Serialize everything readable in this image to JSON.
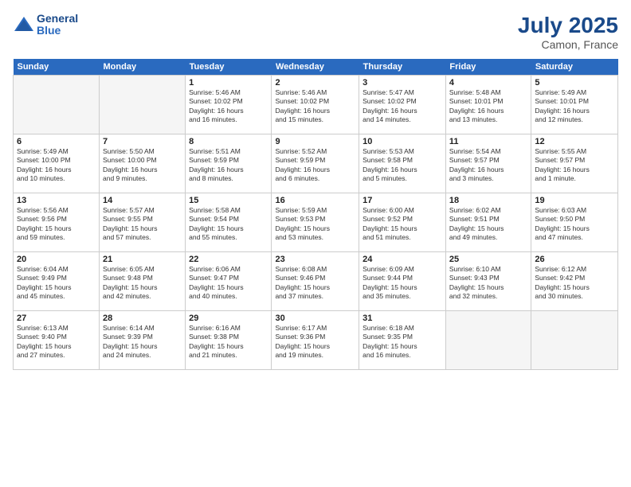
{
  "header": {
    "logo_line1": "General",
    "logo_line2": "Blue",
    "month": "July 2025",
    "location": "Camon, France"
  },
  "weekdays": [
    "Sunday",
    "Monday",
    "Tuesday",
    "Wednesday",
    "Thursday",
    "Friday",
    "Saturday"
  ],
  "weeks": [
    [
      {
        "day": "",
        "info": ""
      },
      {
        "day": "",
        "info": ""
      },
      {
        "day": "1",
        "info": "Sunrise: 5:46 AM\nSunset: 10:02 PM\nDaylight: 16 hours\nand 16 minutes."
      },
      {
        "day": "2",
        "info": "Sunrise: 5:46 AM\nSunset: 10:02 PM\nDaylight: 16 hours\nand 15 minutes."
      },
      {
        "day": "3",
        "info": "Sunrise: 5:47 AM\nSunset: 10:02 PM\nDaylight: 16 hours\nand 14 minutes."
      },
      {
        "day": "4",
        "info": "Sunrise: 5:48 AM\nSunset: 10:01 PM\nDaylight: 16 hours\nand 13 minutes."
      },
      {
        "day": "5",
        "info": "Sunrise: 5:49 AM\nSunset: 10:01 PM\nDaylight: 16 hours\nand 12 minutes."
      }
    ],
    [
      {
        "day": "6",
        "info": "Sunrise: 5:49 AM\nSunset: 10:00 PM\nDaylight: 16 hours\nand 10 minutes."
      },
      {
        "day": "7",
        "info": "Sunrise: 5:50 AM\nSunset: 10:00 PM\nDaylight: 16 hours\nand 9 minutes."
      },
      {
        "day": "8",
        "info": "Sunrise: 5:51 AM\nSunset: 9:59 PM\nDaylight: 16 hours\nand 8 minutes."
      },
      {
        "day": "9",
        "info": "Sunrise: 5:52 AM\nSunset: 9:59 PM\nDaylight: 16 hours\nand 6 minutes."
      },
      {
        "day": "10",
        "info": "Sunrise: 5:53 AM\nSunset: 9:58 PM\nDaylight: 16 hours\nand 5 minutes."
      },
      {
        "day": "11",
        "info": "Sunrise: 5:54 AM\nSunset: 9:57 PM\nDaylight: 16 hours\nand 3 minutes."
      },
      {
        "day": "12",
        "info": "Sunrise: 5:55 AM\nSunset: 9:57 PM\nDaylight: 16 hours\nand 1 minute."
      }
    ],
    [
      {
        "day": "13",
        "info": "Sunrise: 5:56 AM\nSunset: 9:56 PM\nDaylight: 15 hours\nand 59 minutes."
      },
      {
        "day": "14",
        "info": "Sunrise: 5:57 AM\nSunset: 9:55 PM\nDaylight: 15 hours\nand 57 minutes."
      },
      {
        "day": "15",
        "info": "Sunrise: 5:58 AM\nSunset: 9:54 PM\nDaylight: 15 hours\nand 55 minutes."
      },
      {
        "day": "16",
        "info": "Sunrise: 5:59 AM\nSunset: 9:53 PM\nDaylight: 15 hours\nand 53 minutes."
      },
      {
        "day": "17",
        "info": "Sunrise: 6:00 AM\nSunset: 9:52 PM\nDaylight: 15 hours\nand 51 minutes."
      },
      {
        "day": "18",
        "info": "Sunrise: 6:02 AM\nSunset: 9:51 PM\nDaylight: 15 hours\nand 49 minutes."
      },
      {
        "day": "19",
        "info": "Sunrise: 6:03 AM\nSunset: 9:50 PM\nDaylight: 15 hours\nand 47 minutes."
      }
    ],
    [
      {
        "day": "20",
        "info": "Sunrise: 6:04 AM\nSunset: 9:49 PM\nDaylight: 15 hours\nand 45 minutes."
      },
      {
        "day": "21",
        "info": "Sunrise: 6:05 AM\nSunset: 9:48 PM\nDaylight: 15 hours\nand 42 minutes."
      },
      {
        "day": "22",
        "info": "Sunrise: 6:06 AM\nSunset: 9:47 PM\nDaylight: 15 hours\nand 40 minutes."
      },
      {
        "day": "23",
        "info": "Sunrise: 6:08 AM\nSunset: 9:46 PM\nDaylight: 15 hours\nand 37 minutes."
      },
      {
        "day": "24",
        "info": "Sunrise: 6:09 AM\nSunset: 9:44 PM\nDaylight: 15 hours\nand 35 minutes."
      },
      {
        "day": "25",
        "info": "Sunrise: 6:10 AM\nSunset: 9:43 PM\nDaylight: 15 hours\nand 32 minutes."
      },
      {
        "day": "26",
        "info": "Sunrise: 6:12 AM\nSunset: 9:42 PM\nDaylight: 15 hours\nand 30 minutes."
      }
    ],
    [
      {
        "day": "27",
        "info": "Sunrise: 6:13 AM\nSunset: 9:40 PM\nDaylight: 15 hours\nand 27 minutes."
      },
      {
        "day": "28",
        "info": "Sunrise: 6:14 AM\nSunset: 9:39 PM\nDaylight: 15 hours\nand 24 minutes."
      },
      {
        "day": "29",
        "info": "Sunrise: 6:16 AM\nSunset: 9:38 PM\nDaylight: 15 hours\nand 21 minutes."
      },
      {
        "day": "30",
        "info": "Sunrise: 6:17 AM\nSunset: 9:36 PM\nDaylight: 15 hours\nand 19 minutes."
      },
      {
        "day": "31",
        "info": "Sunrise: 6:18 AM\nSunset: 9:35 PM\nDaylight: 15 hours\nand 16 minutes."
      },
      {
        "day": "",
        "info": ""
      },
      {
        "day": "",
        "info": ""
      }
    ]
  ]
}
